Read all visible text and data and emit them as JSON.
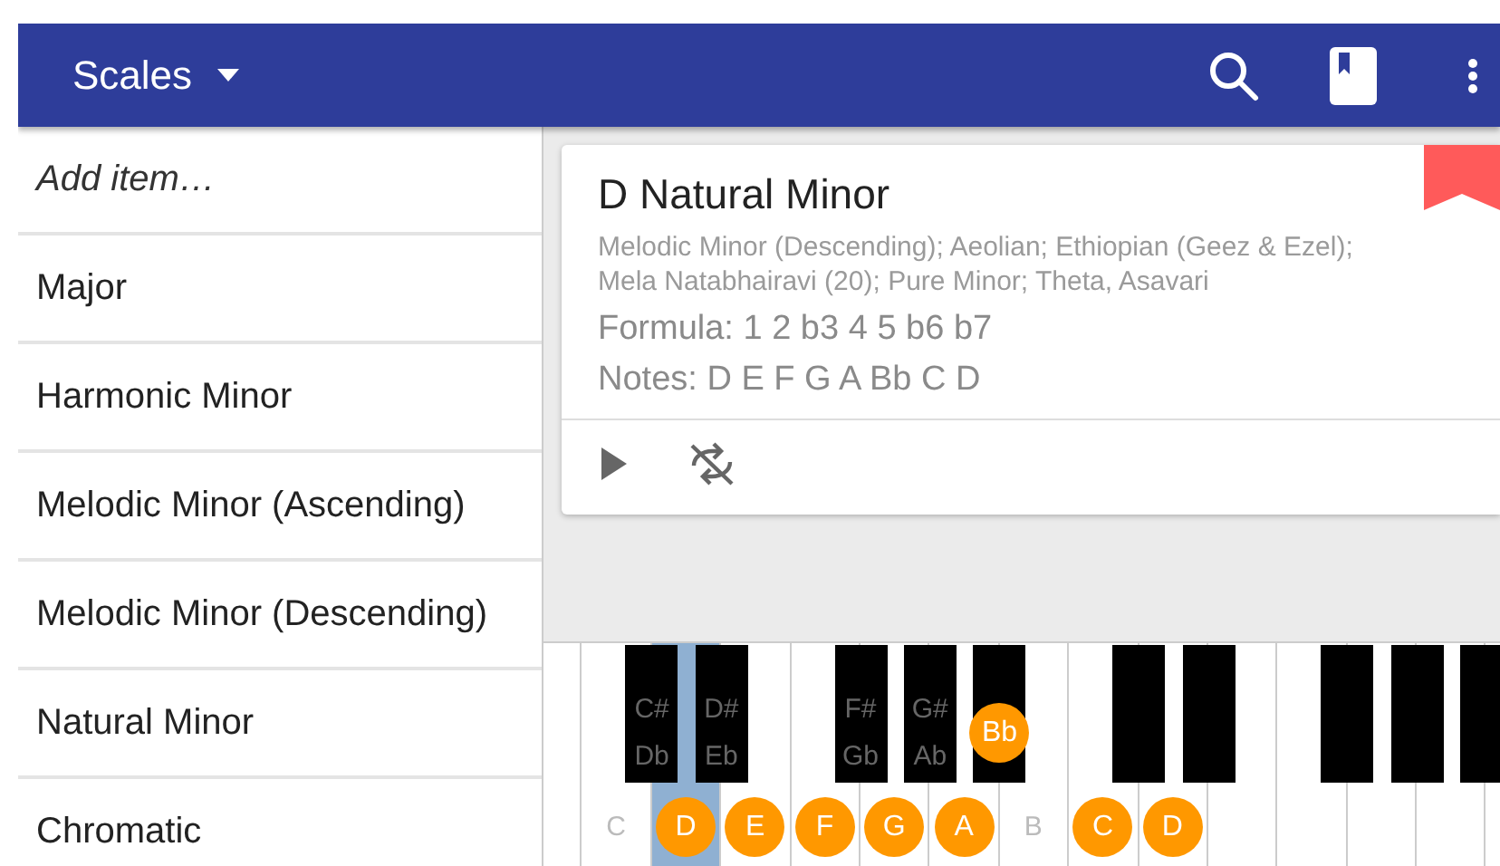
{
  "app_bar": {
    "title": "Scales"
  },
  "list": {
    "placeholder": "Add item…",
    "items": [
      {
        "label": "Major"
      },
      {
        "label": "Harmonic Minor"
      },
      {
        "label": "Melodic Minor (Ascending)"
      },
      {
        "label": "Melodic Minor (Descending)"
      },
      {
        "label": "Natural Minor"
      },
      {
        "label": "Chromatic"
      }
    ]
  },
  "card": {
    "title": "D Natural Minor",
    "aliases": "Melodic Minor (Descending); Aeolian; Ethiopian (Geez & Ezel); Mela Natabhairavi (20); Pure Minor; Theta, Asavari",
    "formula": "Formula: 1 2 b3 4 5 b6 b7",
    "notes": "Notes: D E F G A Bb C D",
    "bookmarked": true
  },
  "keyboard": {
    "white_keys": [
      {
        "pressed": false
      },
      {
        "label": "C",
        "in_scale": false,
        "pressed": false
      },
      {
        "label": "D",
        "in_scale": true,
        "pressed": true
      },
      {
        "label": "E",
        "in_scale": true,
        "pressed": false
      },
      {
        "label": "F",
        "in_scale": true,
        "pressed": false
      },
      {
        "label": "G",
        "in_scale": true,
        "pressed": false
      },
      {
        "label": "A",
        "in_scale": true,
        "pressed": false
      },
      {
        "label": "B",
        "in_scale": false,
        "pressed": false
      },
      {
        "label": "C",
        "in_scale": true,
        "pressed": false
      },
      {
        "label": "D",
        "in_scale": true,
        "pressed": false
      },
      {
        "pressed": false
      },
      {
        "pressed": false
      },
      {
        "pressed": false
      },
      {
        "pressed": false
      }
    ],
    "black_keys": [
      {
        "kind": "labeled",
        "sharp": "C#",
        "flat": "Db"
      },
      {
        "kind": "labeled",
        "sharp": "D#",
        "flat": "Eb"
      },
      {
        "kind": "labeled",
        "sharp": "F#",
        "flat": "Gb"
      },
      {
        "kind": "labeled",
        "sharp": "G#",
        "flat": "Ab"
      },
      {
        "kind": "marked",
        "note": "Bb"
      },
      {
        "kind": "plain"
      },
      {
        "kind": "plain"
      },
      {
        "kind": "plain"
      },
      {
        "kind": "plain"
      },
      {
        "kind": "plain"
      }
    ]
  }
}
